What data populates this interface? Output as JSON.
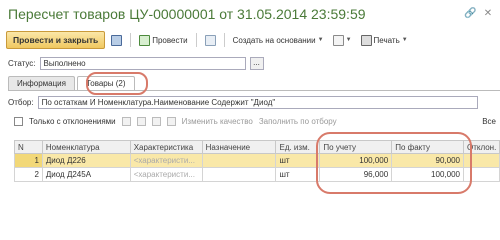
{
  "window": {
    "title": "Пересчет товаров ЦУ-00000001 от 31.05.2014 23:59:59"
  },
  "toolbar": {
    "post_close": "Провести и закрыть",
    "post": "Провести",
    "create_based_on": "Создать на основании",
    "print": "Печать"
  },
  "status": {
    "label": "Статус:",
    "value": "Выполнено",
    "select_btn": "..."
  },
  "tabs": [
    {
      "label": "Информация"
    },
    {
      "label": "Товары (2)"
    }
  ],
  "filter": {
    "label": "Отбор:",
    "value": "По остаткам И Номенклатура.Наименование Содержит \"Диод\""
  },
  "sub_toolbar": {
    "only_deviations": "Только с отклонениями",
    "change_quality": "Изменить качество",
    "fill_by_filter": "Заполнить по отбору",
    "more": "Все"
  },
  "table": {
    "columns": [
      "N",
      "Номенклатура",
      "Характеристика",
      "Назначение",
      "Ед. изм.",
      "По учету",
      "По факту",
      "Отклон."
    ],
    "rows": [
      {
        "n": "1",
        "item": "Диод Д226",
        "characteristic": "<характеристи...",
        "purpose": "",
        "unit": "шт",
        "accounted": "100,000",
        "actual": "90,000"
      },
      {
        "n": "2",
        "item": "Диод Д245А",
        "characteristic": "<характеристи...",
        "purpose": "",
        "unit": "шт",
        "accounted": "96,000",
        "actual": "100,000"
      }
    ]
  },
  "accent_colors": {
    "title": "#4a7a38",
    "highlight": "#d87a6a",
    "primary_button": "#f0c860",
    "selected_row": "#f9e8a8"
  }
}
